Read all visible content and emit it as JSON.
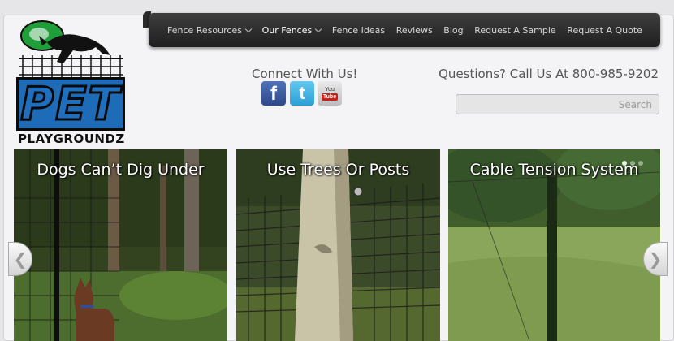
{
  "nav": {
    "items": [
      {
        "label": "Fence Resources",
        "dropdown": true,
        "active": false
      },
      {
        "label": "Our Fences",
        "dropdown": true,
        "active": true
      },
      {
        "label": "Fence Ideas",
        "dropdown": false,
        "active": false
      },
      {
        "label": "Reviews",
        "dropdown": false,
        "active": false
      },
      {
        "label": "Blog",
        "dropdown": false,
        "active": false
      },
      {
        "label": "Request A Sample",
        "dropdown": false,
        "active": false
      },
      {
        "label": "Request A Quote",
        "dropdown": false,
        "active": false
      }
    ]
  },
  "logo": {
    "word": "PET",
    "sub": "PLAYGROUNDZ",
    "colors": {
      "blue": "#1e6bb8",
      "green": "#1f9e3a",
      "black": "#0b0b0b"
    }
  },
  "connect": {
    "title": "Connect With Us!",
    "social": [
      {
        "icon": "facebook-icon",
        "glyph": "f"
      },
      {
        "icon": "twitter-icon",
        "glyph": "t"
      },
      {
        "icon": "youtube-icon",
        "glyph": "You",
        "badge": "Tube"
      }
    ]
  },
  "contact": {
    "questions": "Questions? Call Us At 800-985-9202"
  },
  "search": {
    "placeholder": "Search",
    "value": ""
  },
  "slider": {
    "slides": [
      {
        "title": "Dogs Can’t Dig Under"
      },
      {
        "title": "Use Trees Or Posts"
      },
      {
        "title": "Cable Tension System"
      }
    ],
    "prev_icon": "chevron-left-icon",
    "next_icon": "chevron-right-icon"
  }
}
